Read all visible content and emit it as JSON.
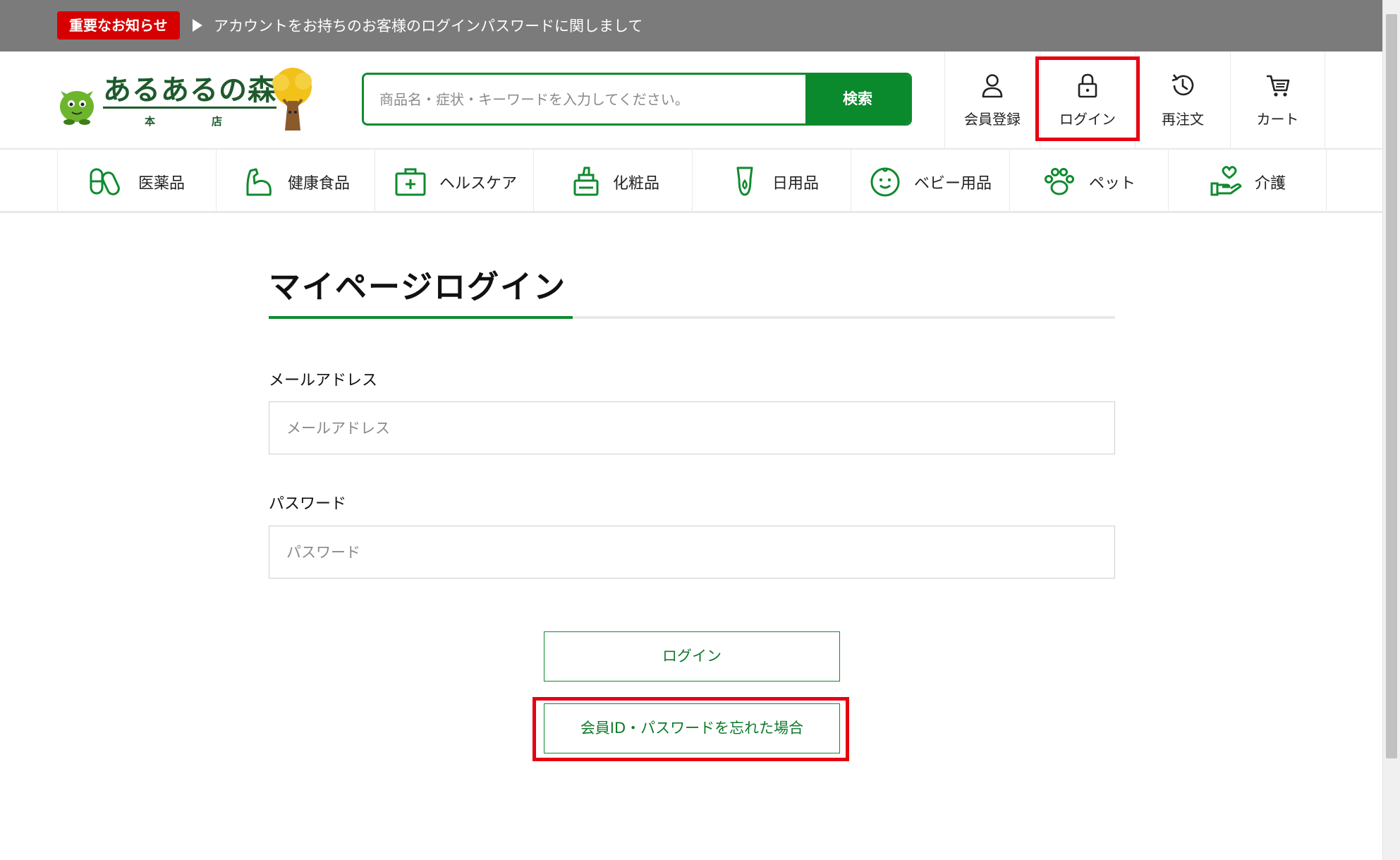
{
  "notice": {
    "badge": "重要なお知らせ",
    "message": "アカウントをお持ちのお客様のログインパスワードに関しまして"
  },
  "header": {
    "logo_text": "あるあるの森",
    "logo_sub": "本店",
    "search_placeholder": "商品名・症状・キーワードを入力してください。",
    "search_button": "検索",
    "util": {
      "register": "会員登録",
      "login": "ログイン",
      "reorder": "再注文",
      "cart": "カート"
    }
  },
  "categories": [
    {
      "label": "医薬品",
      "icon": "capsule-icon"
    },
    {
      "label": "健康食品",
      "icon": "muscle-icon"
    },
    {
      "label": "ヘルスケア",
      "icon": "first-aid-icon"
    },
    {
      "label": "化粧品",
      "icon": "cosmetics-icon"
    },
    {
      "label": "日用品",
      "icon": "bottle-icon"
    },
    {
      "label": "ベビー用品",
      "icon": "baby-face-icon"
    },
    {
      "label": "ペット",
      "icon": "paw-icon"
    },
    {
      "label": "介護",
      "icon": "care-hand-heart-icon"
    }
  ],
  "main": {
    "title": "マイページログイン",
    "email_label": "メールアドレス",
    "email_placeholder": "メールアドレス",
    "password_label": "パスワード",
    "password_placeholder": "パスワード",
    "login_button": "ログイン",
    "forgot_button": "会員ID・パスワードを忘れた場合"
  },
  "colors": {
    "brand_green": "#0f8a2f",
    "notice_bg": "#7b7b7b",
    "badge_red": "#d60000",
    "highlight_red": "#e60012"
  }
}
